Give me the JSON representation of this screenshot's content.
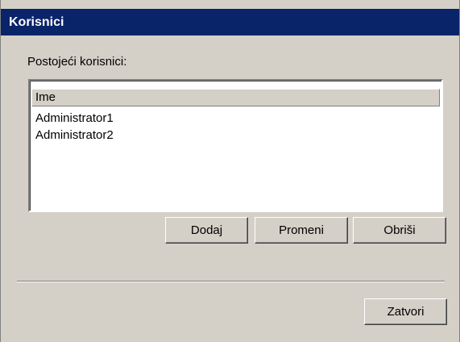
{
  "dialog": {
    "title": "Korisnici",
    "section_label": "Postojeći korisnici:"
  },
  "users_list": {
    "column_header": "Ime",
    "items": [
      "Administrator1",
      "Administrator2"
    ]
  },
  "buttons": {
    "add": "Dodaj",
    "edit": "Promeni",
    "delete": "Obriši",
    "close": "Zatvori"
  },
  "colors": {
    "titlebar": "#0a246a",
    "dialog_bg": "#d4d0c8"
  }
}
